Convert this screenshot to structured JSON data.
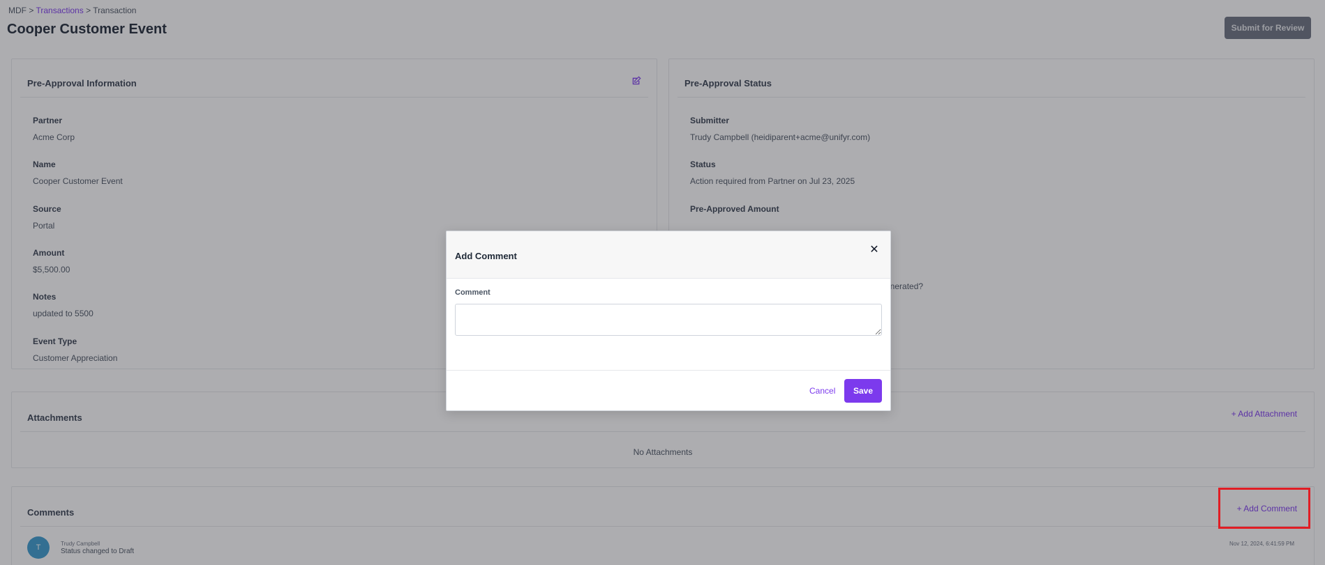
{
  "breadcrumb": {
    "root": "MDF",
    "sep1": ">",
    "link": "Transactions",
    "sep2": ">",
    "current": "Transaction"
  },
  "page": {
    "title": "Cooper Customer Event",
    "submit_label": "Submit for Review"
  },
  "pre_approval_info": {
    "title": "Pre-Approval Information",
    "fields": [
      {
        "label": "Partner",
        "value": "Acme Corp"
      },
      {
        "label": "Name",
        "value": "Cooper Customer Event"
      },
      {
        "label": "Source",
        "value": "Portal"
      },
      {
        "label": "Amount",
        "value": "$5,500.00"
      },
      {
        "label": "Notes",
        "value": "updated to 5500"
      },
      {
        "label": "Event Type",
        "value": "Customer Appreciation"
      }
    ]
  },
  "pre_approval_status": {
    "title": "Pre-Approval Status",
    "fields": [
      {
        "label": "Submitter",
        "value": "Trudy Campbell (heidiparent+acme@unifyr.com)"
      },
      {
        "label": "Status",
        "value": "Action required from Partner on Jul 23, 2025"
      },
      {
        "label": "Pre-Approved Amount",
        "value": ""
      }
    ],
    "partial_text": "enerated?"
  },
  "attachments": {
    "title": "Attachments",
    "add_label": "+ Add Attachment",
    "empty": "No Attachments"
  },
  "comments": {
    "title": "Comments",
    "add_label": "+ Add Comment",
    "items": [
      {
        "avatar": "T",
        "author": "Trudy Campbell",
        "text": "Status changed to Draft",
        "date": "Nov 12, 2024, 6:41:59 PM"
      }
    ]
  },
  "modal": {
    "title": "Add Comment",
    "close_glyph": "✕",
    "field_label": "Comment",
    "value": "",
    "cancel_label": "Cancel",
    "save_label": "Save"
  },
  "colors": {
    "accent": "#7c3aed",
    "highlight": "#e11d24"
  }
}
